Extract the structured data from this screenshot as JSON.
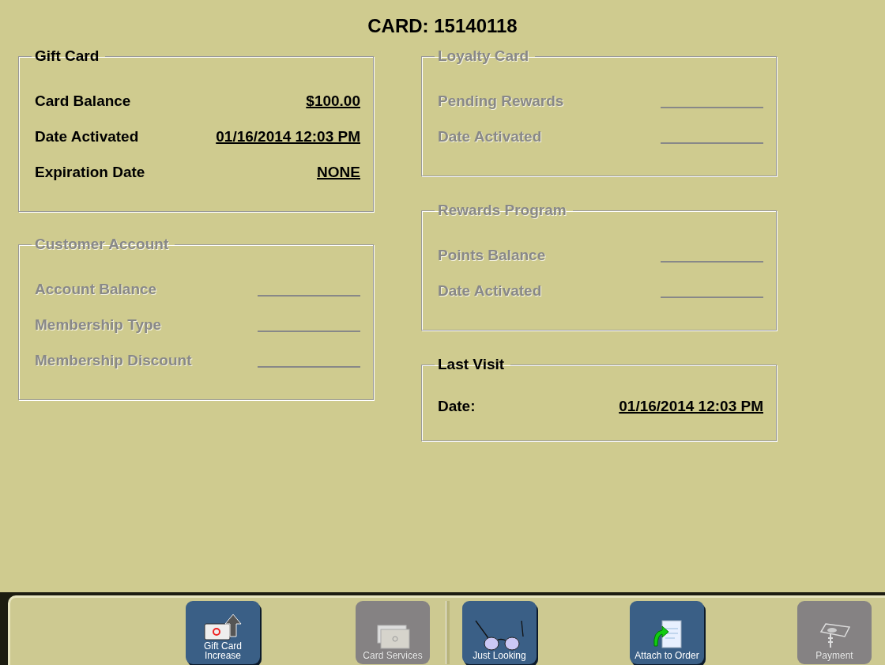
{
  "title": "CARD: 15140118",
  "columns": [
    [
      {
        "title": "Gift Card",
        "disabled": false,
        "rows": [
          {
            "label": "Card Balance",
            "value": "$100.00"
          },
          {
            "label": "Date Activated",
            "value": "01/16/2014 12:03 PM"
          },
          {
            "label": "Expiration Date",
            "value": "NONE"
          }
        ]
      },
      {
        "title": "Customer Account",
        "disabled": true,
        "rows": [
          {
            "label": "Account Balance"
          },
          {
            "label": "Membership Type"
          },
          {
            "label": "Membership Discount"
          }
        ]
      }
    ],
    [
      {
        "title": "Loyalty Card",
        "disabled": true,
        "rows": [
          {
            "label": "Pending Rewards"
          },
          {
            "label": "Date Activated"
          }
        ]
      },
      {
        "title": "Rewards Program",
        "disabled": true,
        "rows": [
          {
            "label": "Points Balance"
          },
          {
            "label": "Date Activated"
          }
        ]
      },
      {
        "title": "Last Visit",
        "disabled": false,
        "rows": [
          {
            "label": "Date:",
            "value": "01/16/2014 12:03 PM"
          }
        ]
      }
    ]
  ],
  "toolbar": [
    {
      "label": "Gift Card Increase",
      "kind": "card-up",
      "disabled": false
    },
    {
      "label": "Card Services",
      "kind": "cards",
      "disabled": true
    },
    {
      "label": "Just Looking",
      "kind": "glasses",
      "disabled": false
    },
    {
      "label": "Attach to Order",
      "kind": "attach",
      "disabled": false
    },
    {
      "label": "Payment",
      "kind": "payment",
      "disabled": true
    }
  ]
}
